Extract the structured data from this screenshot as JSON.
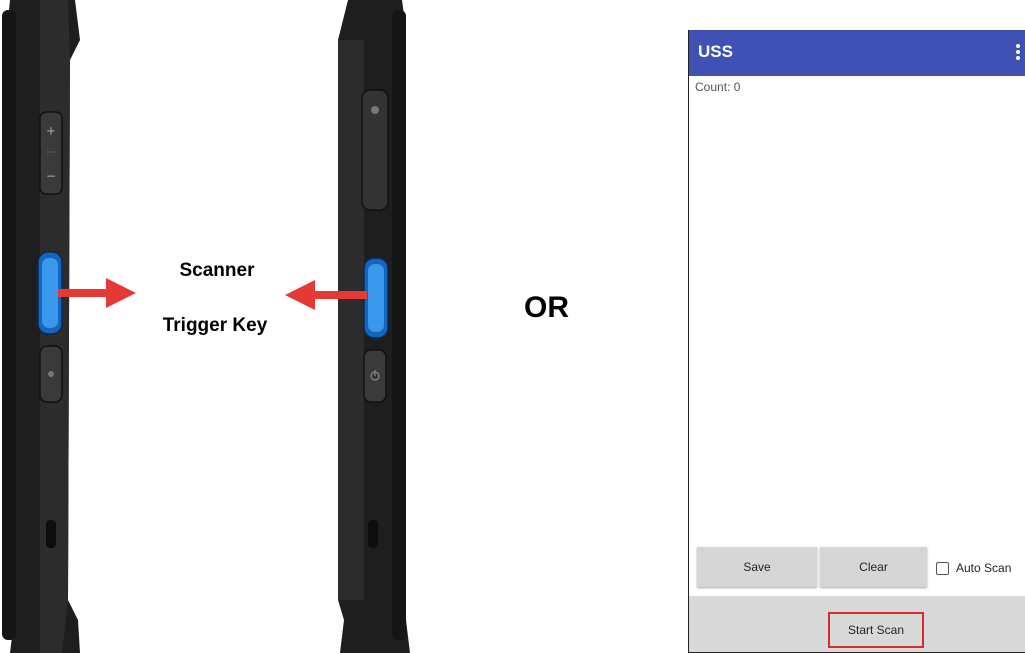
{
  "callout": {
    "line1": "Scanner",
    "line2": "Trigger Key",
    "arrow_color": "#e53935"
  },
  "separator": "OR",
  "app": {
    "title": "USS",
    "app_bar_color": "#3f51b5",
    "menu_icon": "overflow-menu-icon",
    "count_label": "Count:",
    "count_value": "0",
    "save_label": "Save",
    "clear_label": "Clear",
    "auto_scan_label": "Auto Scan",
    "auto_scan_checked": false,
    "start_scan_label": "Start Scan",
    "highlight_color": "#d32f2f"
  },
  "devices": {
    "left_keys": [
      "volume-up-icon",
      "volume-down-icon",
      "scanner-trigger-key",
      "power-key"
    ],
    "right_keys": [
      "sim-slot-cover",
      "scanner-trigger-key",
      "power-key"
    ],
    "trigger_key_color": "#1e88e5"
  }
}
